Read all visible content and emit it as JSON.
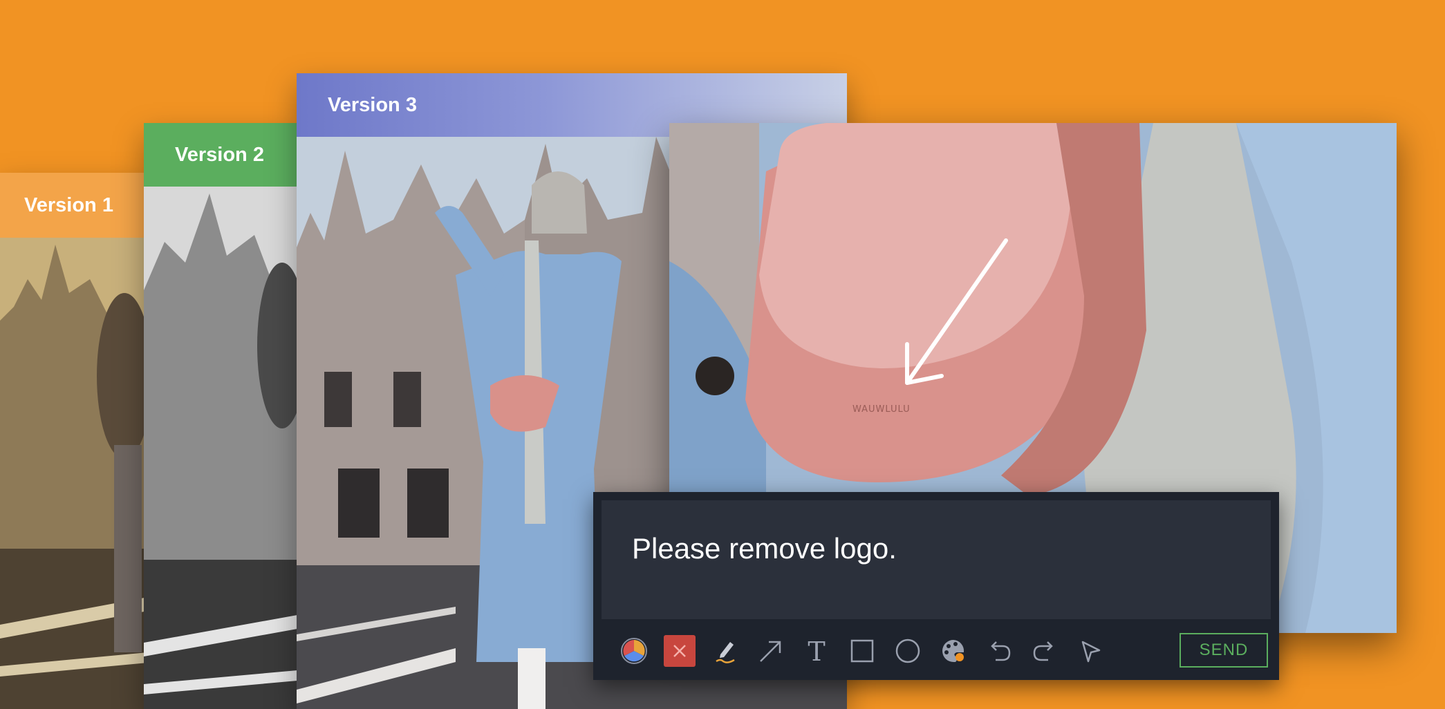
{
  "versions": [
    {
      "label": "Version 1",
      "color": "#F3A449"
    },
    {
      "label": "Version 2",
      "color": "#5BAE5E"
    },
    {
      "label": "Version 3",
      "color": "#6E78C9"
    }
  ],
  "zoom_card": {
    "arrow_color": "#FFFFFF",
    "bag_color": "#D9918A"
  },
  "comment": {
    "text": "Please remove logo.",
    "panel_color": "#1E232D"
  },
  "toolbar": {
    "tools": [
      "color-picker-icon",
      "delete-icon",
      "highlighter-icon",
      "arrow-icon",
      "text-icon",
      "rectangle-icon",
      "circle-icon",
      "palette-icon",
      "undo-icon",
      "redo-icon",
      "pointer-icon"
    ],
    "send_label": "SEND"
  },
  "background_color": "#F19323"
}
